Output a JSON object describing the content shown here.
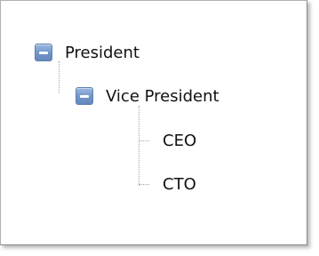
{
  "tree": {
    "nodes": [
      {
        "label": "President",
        "expanded": true,
        "icon": "collapse-minus-icon"
      },
      {
        "label": "Vice President",
        "expanded": true,
        "icon": "collapse-minus-icon"
      },
      {
        "label": "CEO"
      },
      {
        "label": "CTO"
      }
    ]
  },
  "colors": {
    "toggle_fill": "#7194c9",
    "toggle_border": "#5d7fae",
    "connector": "#9aa7bf",
    "text": "#111111"
  }
}
